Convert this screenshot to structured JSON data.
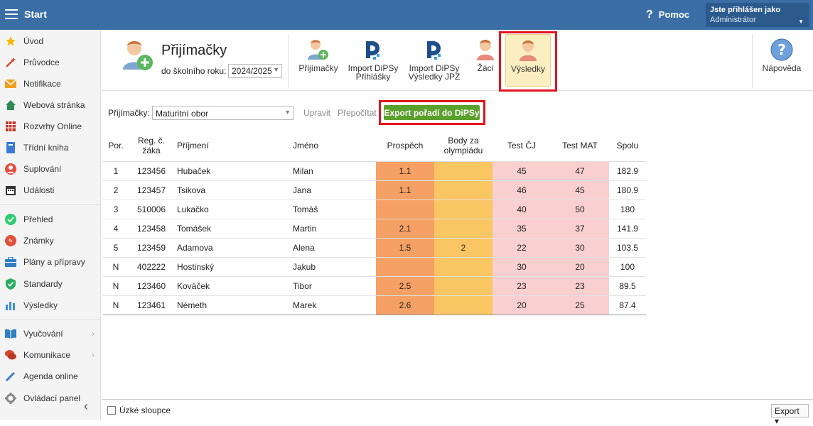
{
  "topbar": {
    "start": "Start",
    "help": "Pomoc",
    "help_icon": "?",
    "user_line1": "Jste přihlášen jako",
    "user_line2": "Administrátor"
  },
  "sidebar": {
    "items": [
      {
        "label": "Úvod",
        "icon": "star-icon"
      },
      {
        "label": "Průvodce",
        "icon": "wand-icon"
      },
      {
        "label": "Notifikace",
        "icon": "envelope-icon"
      },
      {
        "label": "Webová stránka",
        "icon": "home-icon"
      },
      {
        "label": "Rozvrhy Online",
        "icon": "calendar-grid-icon"
      },
      {
        "label": "Třídní kniha",
        "icon": "book-icon"
      },
      {
        "label": "Suplování",
        "icon": "person-icon"
      },
      {
        "label": "Události",
        "icon": "calendar-icon"
      },
      {
        "label": "Přehled",
        "icon": "check-circle-icon"
      },
      {
        "label": "Známky",
        "icon": "grades-icon"
      },
      {
        "label": "Plány a přípravy",
        "icon": "briefcase-icon"
      },
      {
        "label": "Standardy",
        "icon": "shield-check-icon"
      },
      {
        "label": "Výsledky",
        "icon": "bar-chart-icon"
      },
      {
        "label": "Vyučování",
        "icon": "book-open-icon"
      },
      {
        "label": "Komunikace",
        "icon": "chat-icon"
      },
      {
        "label": "Agenda online",
        "icon": "pen-icon"
      },
      {
        "label": "Ovládací panel",
        "icon": "gear-icon"
      }
    ],
    "collapse": "‹",
    "submenu_arrow": "›"
  },
  "module": {
    "title": "Přijímačky",
    "year_label": "do školního roku:",
    "year_value": "2024/2025"
  },
  "toolbar": {
    "b1": "Přijímačky",
    "b2_l1": "Import DiPSy",
    "b2_l2": "Přihlášky",
    "b3_l1": "Import DiPSy",
    "b3_l2": "Výsledky JPZ",
    "b4": "Žáci",
    "b5": "Výsledky",
    "b6": "Nápověda"
  },
  "filter": {
    "label": "Přijímačky:",
    "value": "Maturitní obor",
    "edit": "Upravit",
    "recalc": "Přepočítat",
    "export_btn": "Export pořadí do DiPSy"
  },
  "table": {
    "headers": {
      "por": "Por.",
      "reg_l1": "Reg. č.",
      "reg_l2": "žáka",
      "prijmeni": "Příjmení",
      "jmeno": "Jméno",
      "prospech": "Prospěch",
      "body_l1": "Body za",
      "body_l2": "olympiádu",
      "test_cj": "Test ČJ",
      "test_mat": "Test MAT",
      "spolu": "Spolu"
    },
    "rows": [
      {
        "por": "1",
        "reg": "123456",
        "prijmeni": "Hubaček",
        "jmeno": "Milan",
        "prospech": "1.1",
        "body": "",
        "cj": "45",
        "mat": "47",
        "spolu": "182.9"
      },
      {
        "por": "2",
        "reg": "123457",
        "prijmeni": "Tsikova",
        "jmeno": "Jana",
        "prospech": "1.1",
        "body": "",
        "cj": "46",
        "mat": "45",
        "spolu": "180.9"
      },
      {
        "por": "3",
        "reg": "510006",
        "prijmeni": "Lukačko",
        "jmeno": "Tomáš",
        "prospech": "",
        "body": "",
        "cj": "40",
        "mat": "50",
        "spolu": "180"
      },
      {
        "por": "4",
        "reg": "123458",
        "prijmeni": "Tomášek",
        "jmeno": "Martin",
        "prospech": "2.1",
        "body": "",
        "cj": "35",
        "mat": "37",
        "spolu": "141.9"
      },
      {
        "por": "5",
        "reg": "123459",
        "prijmeni": "Adamova",
        "jmeno": "Alena",
        "prospech": "1.5",
        "body": "2",
        "cj": "22",
        "mat": "30",
        "spolu": "103.5"
      },
      {
        "por": "N",
        "reg": "402222",
        "prijmeni": "Hostinský",
        "jmeno": "Jakub",
        "prospech": "",
        "body": "",
        "cj": "30",
        "mat": "20",
        "spolu": "100"
      },
      {
        "por": "N",
        "reg": "123460",
        "prijmeni": "Kováček",
        "jmeno": "Tibor",
        "prospech": "2.5",
        "body": "",
        "cj": "23",
        "mat": "23",
        "spolu": "89.5"
      },
      {
        "por": "N",
        "reg": "123461",
        "prijmeni": "Németh",
        "jmeno": "Marek",
        "prospech": "2.6",
        "body": "",
        "cj": "20",
        "mat": "25",
        "spolu": "87.4"
      }
    ]
  },
  "footer": {
    "narrow_cols": "Úzké sloupce",
    "export": "Export ▾"
  },
  "colors": {
    "topbar": "#3a6ea5",
    "prospech": "#f5a064",
    "body": "#f9c663",
    "test": "#f9cfcf",
    "green_btn": "#5aa02c",
    "highlight": "#e0141e"
  }
}
